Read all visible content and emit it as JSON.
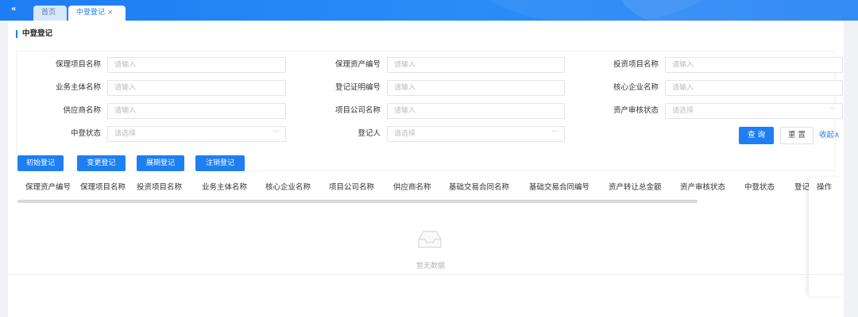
{
  "tabs": {
    "collapse": "«",
    "home": "首页",
    "active": "中登登记",
    "close": "×"
  },
  "page_title": "中登登记",
  "filters": [
    {
      "label": "保理项目名称",
      "placeholder": "请输入",
      "type": "input"
    },
    {
      "label": "保理资产编号",
      "placeholder": "请输入",
      "type": "input"
    },
    {
      "label": "投资项目名称",
      "placeholder": "请输入",
      "type": "input"
    },
    {
      "label": "业务主体名称",
      "placeholder": "请输入",
      "type": "input"
    },
    {
      "label": "登记证明编号",
      "placeholder": "请输入",
      "type": "input"
    },
    {
      "label": "核心企业名称",
      "placeholder": "请输入",
      "type": "input"
    },
    {
      "label": "供应商名称",
      "placeholder": "请输入",
      "type": "input"
    },
    {
      "label": "项目公司名称",
      "placeholder": "请输入",
      "type": "input"
    },
    {
      "label": "资产审核状态",
      "placeholder": "请选择",
      "type": "select"
    },
    {
      "label": "中登状态",
      "placeholder": "请选择",
      "type": "select"
    },
    {
      "label": "登记人",
      "placeholder": "请选择",
      "type": "select"
    }
  ],
  "buttons": {
    "query": "查 询",
    "reset": "重 置",
    "collapse": "收起∧"
  },
  "actions": [
    "初始登记",
    "变更登记",
    "展期登记",
    "注销登记"
  ],
  "table": {
    "columns": [
      "保理资产编号",
      "保理项目名称",
      "投资项目名称",
      "业务主体名称",
      "核心企业名称",
      "项目公司名称",
      "供应商名称",
      "基础交易合同名称",
      "基础交易合同编号",
      "资产转让总金额",
      "资产审核状态",
      "中登状态",
      "登记"
    ],
    "operation": "操作",
    "empty": "暂无数据"
  },
  "icons": {
    "collapse": "double-chevron-left-icon",
    "select_arrow": "chevron-down-icon",
    "empty": "empty-inbox-icon"
  },
  "colors": {
    "primary": "#1e7ff3"
  }
}
